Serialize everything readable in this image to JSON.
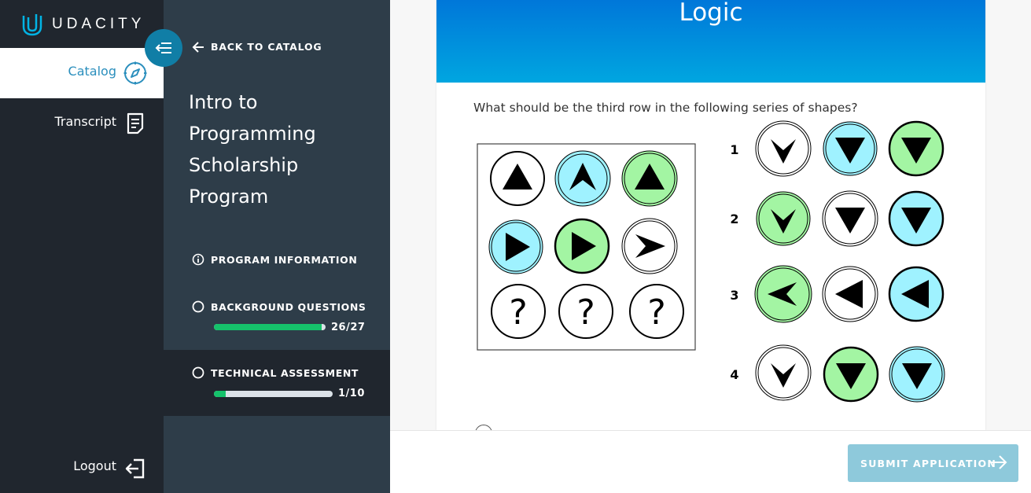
{
  "brand": {
    "name": "UDACITY"
  },
  "nav": {
    "catalog_label": "Catalog",
    "transcript_label": "Transcript",
    "logout_label": "Logout"
  },
  "sidebar": {
    "back_label": "BACK TO CATALOG",
    "program_title_lines": [
      "Intro to",
      "Programming",
      "Scholarship",
      "Program"
    ],
    "items": [
      {
        "label": "PROGRAM INFORMATION"
      },
      {
        "label": "BACKGROUND QUESTIONS",
        "progress_text": "26/27",
        "progress": 0.963
      },
      {
        "label": "TECHNICAL ASSESSMENT",
        "progress_text": "1/10",
        "progress": 0.1
      }
    ]
  },
  "main": {
    "section_title": "Logic",
    "question": "What should be the third row in the following series of shapes?",
    "options": [
      "1",
      "2",
      "3",
      "4"
    ]
  },
  "footer": {
    "submit_label": "SUBMIT APPLICATION"
  },
  "colors": {
    "nav_bg": "#20262e",
    "sidebar_bg": "#2e3d49",
    "accent": "#02b3e4",
    "progress_green": "#15c26b",
    "shape_blue": "#9ff2ff",
    "shape_green": "#a3f5a3"
  }
}
